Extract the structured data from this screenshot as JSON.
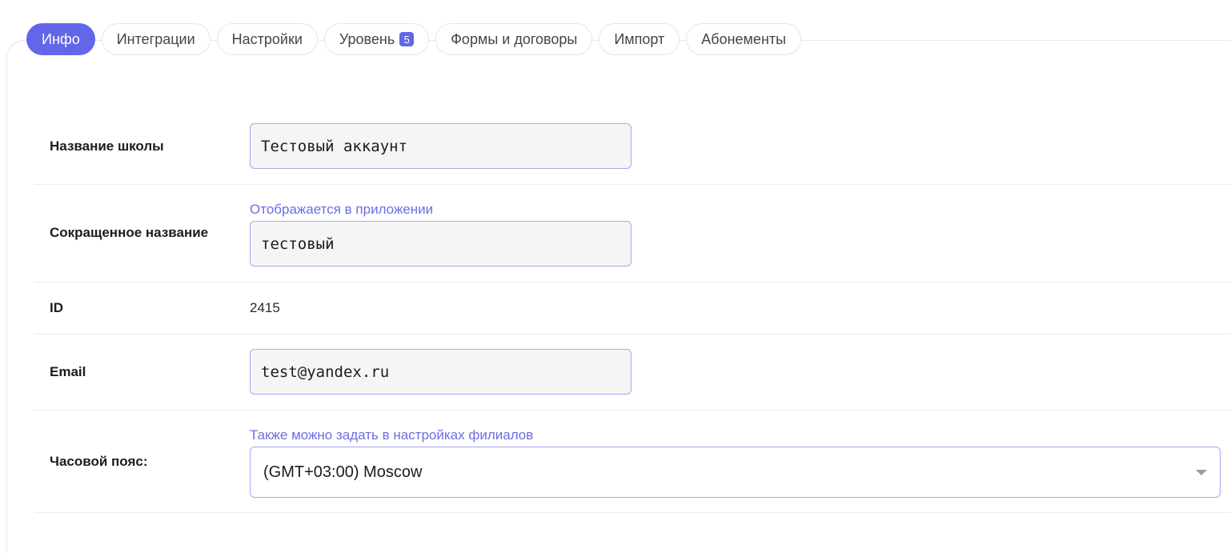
{
  "tabs": [
    {
      "label": "Инфо",
      "active": true
    },
    {
      "label": "Интеграции"
    },
    {
      "label": "Настройки"
    },
    {
      "label": "Уровень",
      "badge": "5"
    },
    {
      "label": "Формы и договоры"
    },
    {
      "label": "Импорт"
    },
    {
      "label": "Абонементы"
    }
  ],
  "form": {
    "school_name": {
      "label": "Название школы",
      "value": "Тестовый аккаунт"
    },
    "short_name": {
      "label": "Сокращенное название",
      "hint": "Отображается в приложении",
      "value": "тестовый"
    },
    "id": {
      "label": "ID",
      "value": "2415"
    },
    "email": {
      "label": "Email",
      "value": "test@yandex.ru"
    },
    "timezone": {
      "label": "Часовой пояс:",
      "hint": "Также можно задать в настройках филиалов",
      "value": "(GMT+03:00) Moscow"
    }
  },
  "colors": {
    "accent": "#6366e8",
    "hint": "#6d6de4",
    "field_border": "#a9a6ec"
  }
}
